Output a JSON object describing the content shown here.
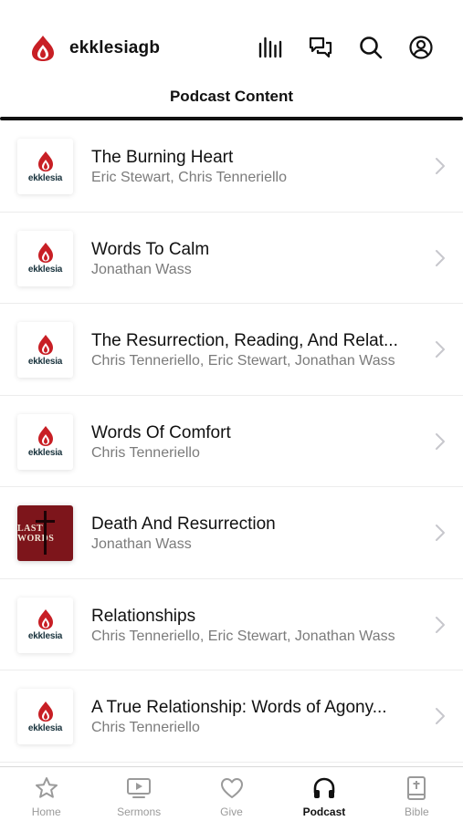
{
  "header": {
    "brand": "ekklesiagb",
    "page_title": "Podcast Content",
    "icons": [
      "bars-icon",
      "chat-icon",
      "search-icon",
      "profile-icon"
    ]
  },
  "colors": {
    "brand_red": "#c81f25",
    "dark_red": "#7d151b",
    "active": "#111111",
    "inactive": "#9a9a9a"
  },
  "podcasts": [
    {
      "title": "The Burning Heart",
      "authors": "Eric Stewart, Chris Tenneriello",
      "thumb": "ekklesia"
    },
    {
      "title": "Words To Calm",
      "authors": "Jonathan Wass",
      "thumb": "ekklesia"
    },
    {
      "title": "The Resurrection, Reading, And Relat...",
      "authors": "Chris Tenneriello, Eric Stewart, Jonathan Wass",
      "thumb": "ekklesia"
    },
    {
      "title": "Words Of Comfort",
      "authors": "Chris Tenneriello",
      "thumb": "ekklesia"
    },
    {
      "title": "Death And Resurrection",
      "authors": "Jonathan Wass",
      "thumb": "last-words"
    },
    {
      "title": "Relationships",
      "authors": "Chris Tenneriello, Eric Stewart, Jonathan Wass",
      "thumb": "ekklesia"
    },
    {
      "title": "A True Relationship: Words of Agony...",
      "authors": "Chris Tenneriello",
      "thumb": "ekklesia"
    }
  ],
  "thumb_labels": {
    "ekklesia": "ekklesia",
    "last_words": "LAST WORDS"
  },
  "tabs": [
    {
      "label": "Home",
      "icon": "star-icon",
      "active": false
    },
    {
      "label": "Sermons",
      "icon": "play-screen-icon",
      "active": false
    },
    {
      "label": "Give",
      "icon": "heart-icon",
      "active": false
    },
    {
      "label": "Podcast",
      "icon": "headphones-icon",
      "active": true
    },
    {
      "label": "Bible",
      "icon": "bible-icon",
      "active": false
    }
  ]
}
